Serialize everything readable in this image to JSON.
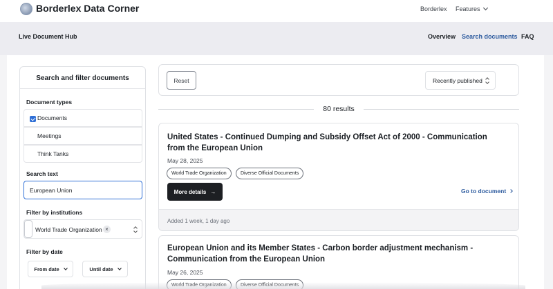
{
  "app": {
    "brand": "Borderlex Data Corner",
    "top_nav": {
      "borderlex": "Borderlex",
      "features": "Features"
    }
  },
  "subheader": {
    "title": "Live Document Hub",
    "nav": {
      "overview": "Overview",
      "search": "Search documents",
      "faq": "FAQ"
    }
  },
  "filters": {
    "title": "Search and filter documents",
    "doc_types_label": "Document types",
    "doc_types": [
      {
        "label": "Documents",
        "checked": true
      },
      {
        "label": "Meetings",
        "checked": false
      },
      {
        "label": "Think Tanks",
        "checked": false
      }
    ],
    "search_text_label": "Search text",
    "search_text_value": "European Union",
    "institutions_label": "Filter by institutions",
    "institution_selected": "World Trade Organization",
    "date_label": "Filter by date",
    "from_date": "From date",
    "until_date": "Until date"
  },
  "toolbar": {
    "reset_label": "Reset",
    "sort_value": "Recently published"
  },
  "results": {
    "count": "80 results",
    "items": [
      {
        "title": "United States - Continued Dumping and Subsidy Offset Act of 2000 - Communication from the European Union",
        "date": "May 28, 2025",
        "tags": [
          "World Trade Organization",
          "Diverse Official Documents"
        ],
        "more_label": "More details",
        "goto_label": "Go to document",
        "added": "Added 1 week, 1 day ago"
      },
      {
        "title": "European Union and its Member States - Carbon border adjustment mechanism - Communication from the European Union",
        "date": "May 26, 2025",
        "tags": [
          "World Trade Organization",
          "Diverse Official Documents"
        ]
      }
    ]
  },
  "colors": {
    "accent": "#2f6fd6",
    "link": "#2c5a9e",
    "primary_button": "#1d1f23"
  }
}
